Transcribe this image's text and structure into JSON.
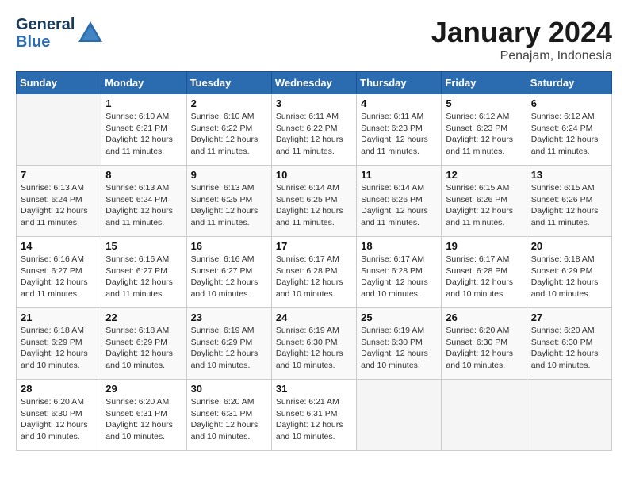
{
  "header": {
    "logo_line1": "General",
    "logo_line2": "Blue",
    "month": "January 2024",
    "location": "Penajam, Indonesia"
  },
  "days_of_week": [
    "Sunday",
    "Monday",
    "Tuesday",
    "Wednesday",
    "Thursday",
    "Friday",
    "Saturday"
  ],
  "weeks": [
    [
      {
        "day": "",
        "info": ""
      },
      {
        "day": "1",
        "info": "Sunrise: 6:10 AM\nSunset: 6:21 PM\nDaylight: 12 hours\nand 11 minutes."
      },
      {
        "day": "2",
        "info": "Sunrise: 6:10 AM\nSunset: 6:22 PM\nDaylight: 12 hours\nand 11 minutes."
      },
      {
        "day": "3",
        "info": "Sunrise: 6:11 AM\nSunset: 6:22 PM\nDaylight: 12 hours\nand 11 minutes."
      },
      {
        "day": "4",
        "info": "Sunrise: 6:11 AM\nSunset: 6:23 PM\nDaylight: 12 hours\nand 11 minutes."
      },
      {
        "day": "5",
        "info": "Sunrise: 6:12 AM\nSunset: 6:23 PM\nDaylight: 12 hours\nand 11 minutes."
      },
      {
        "day": "6",
        "info": "Sunrise: 6:12 AM\nSunset: 6:24 PM\nDaylight: 12 hours\nand 11 minutes."
      }
    ],
    [
      {
        "day": "7",
        "info": "Sunrise: 6:13 AM\nSunset: 6:24 PM\nDaylight: 12 hours\nand 11 minutes."
      },
      {
        "day": "8",
        "info": "Sunrise: 6:13 AM\nSunset: 6:24 PM\nDaylight: 12 hours\nand 11 minutes."
      },
      {
        "day": "9",
        "info": "Sunrise: 6:13 AM\nSunset: 6:25 PM\nDaylight: 12 hours\nand 11 minutes."
      },
      {
        "day": "10",
        "info": "Sunrise: 6:14 AM\nSunset: 6:25 PM\nDaylight: 12 hours\nand 11 minutes."
      },
      {
        "day": "11",
        "info": "Sunrise: 6:14 AM\nSunset: 6:26 PM\nDaylight: 12 hours\nand 11 minutes."
      },
      {
        "day": "12",
        "info": "Sunrise: 6:15 AM\nSunset: 6:26 PM\nDaylight: 12 hours\nand 11 minutes."
      },
      {
        "day": "13",
        "info": "Sunrise: 6:15 AM\nSunset: 6:26 PM\nDaylight: 12 hours\nand 11 minutes."
      }
    ],
    [
      {
        "day": "14",
        "info": "Sunrise: 6:16 AM\nSunset: 6:27 PM\nDaylight: 12 hours\nand 11 minutes."
      },
      {
        "day": "15",
        "info": "Sunrise: 6:16 AM\nSunset: 6:27 PM\nDaylight: 12 hours\nand 11 minutes."
      },
      {
        "day": "16",
        "info": "Sunrise: 6:16 AM\nSunset: 6:27 PM\nDaylight: 12 hours\nand 10 minutes."
      },
      {
        "day": "17",
        "info": "Sunrise: 6:17 AM\nSunset: 6:28 PM\nDaylight: 12 hours\nand 10 minutes."
      },
      {
        "day": "18",
        "info": "Sunrise: 6:17 AM\nSunset: 6:28 PM\nDaylight: 12 hours\nand 10 minutes."
      },
      {
        "day": "19",
        "info": "Sunrise: 6:17 AM\nSunset: 6:28 PM\nDaylight: 12 hours\nand 10 minutes."
      },
      {
        "day": "20",
        "info": "Sunrise: 6:18 AM\nSunset: 6:29 PM\nDaylight: 12 hours\nand 10 minutes."
      }
    ],
    [
      {
        "day": "21",
        "info": "Sunrise: 6:18 AM\nSunset: 6:29 PM\nDaylight: 12 hours\nand 10 minutes."
      },
      {
        "day": "22",
        "info": "Sunrise: 6:18 AM\nSunset: 6:29 PM\nDaylight: 12 hours\nand 10 minutes."
      },
      {
        "day": "23",
        "info": "Sunrise: 6:19 AM\nSunset: 6:29 PM\nDaylight: 12 hours\nand 10 minutes."
      },
      {
        "day": "24",
        "info": "Sunrise: 6:19 AM\nSunset: 6:30 PM\nDaylight: 12 hours\nand 10 minutes."
      },
      {
        "day": "25",
        "info": "Sunrise: 6:19 AM\nSunset: 6:30 PM\nDaylight: 12 hours\nand 10 minutes."
      },
      {
        "day": "26",
        "info": "Sunrise: 6:20 AM\nSunset: 6:30 PM\nDaylight: 12 hours\nand 10 minutes."
      },
      {
        "day": "27",
        "info": "Sunrise: 6:20 AM\nSunset: 6:30 PM\nDaylight: 12 hours\nand 10 minutes."
      }
    ],
    [
      {
        "day": "28",
        "info": "Sunrise: 6:20 AM\nSunset: 6:30 PM\nDaylight: 12 hours\nand 10 minutes."
      },
      {
        "day": "29",
        "info": "Sunrise: 6:20 AM\nSunset: 6:31 PM\nDaylight: 12 hours\nand 10 minutes."
      },
      {
        "day": "30",
        "info": "Sunrise: 6:20 AM\nSunset: 6:31 PM\nDaylight: 12 hours\nand 10 minutes."
      },
      {
        "day": "31",
        "info": "Sunrise: 6:21 AM\nSunset: 6:31 PM\nDaylight: 12 hours\nand 10 minutes."
      },
      {
        "day": "",
        "info": ""
      },
      {
        "day": "",
        "info": ""
      },
      {
        "day": "",
        "info": ""
      }
    ]
  ]
}
